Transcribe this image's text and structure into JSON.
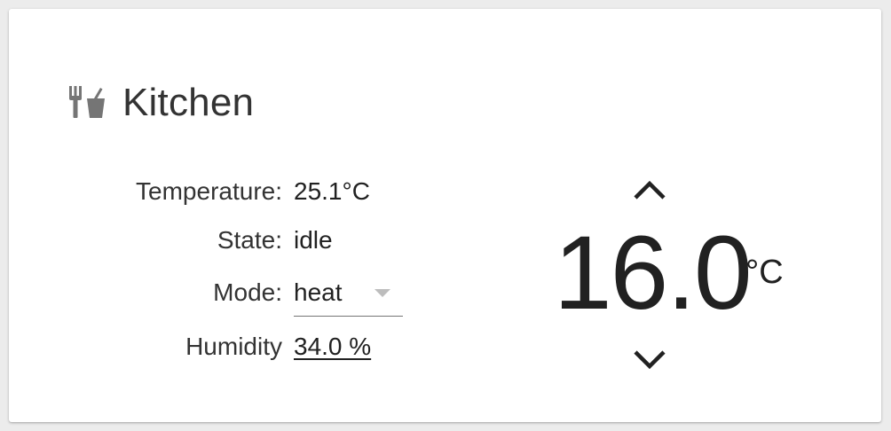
{
  "card": {
    "title": "Kitchen",
    "icon": "silverware-icon",
    "icon_color": "#757575"
  },
  "attributes": {
    "temperature": {
      "label": "Temperature:",
      "value": "25.1°C"
    },
    "state": {
      "label": "State:",
      "value": "idle"
    },
    "mode": {
      "label": "Mode:",
      "value": "heat"
    },
    "humidity": {
      "label": "Humidity",
      "value": "34.0 %"
    }
  },
  "thermostat": {
    "target_temperature": "16.0",
    "unit": "°C"
  }
}
